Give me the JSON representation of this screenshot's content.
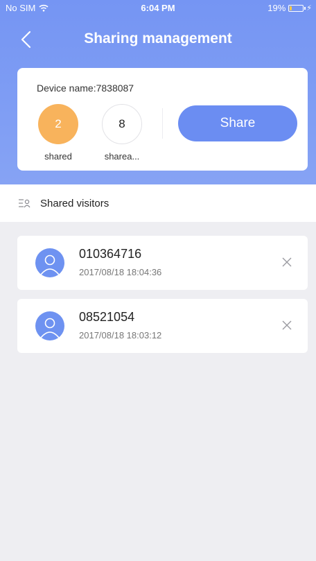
{
  "status_bar": {
    "carrier": "No SIM",
    "time": "6:04 PM",
    "battery": "19%",
    "battery_level": 0.19,
    "icons": [
      "wifi-icon",
      "battery-icon",
      "charging-icon"
    ]
  },
  "header": {
    "title": "Sharing management",
    "back_icon": "chevron-left-icon"
  },
  "device_card": {
    "device_name": "Device name:7838087",
    "shared_count": "2",
    "shared_label": "shared",
    "shareable_count": "8",
    "shareable_label": "sharea...",
    "share_button": "Share"
  },
  "visitors_section": {
    "title": "Shared visitors",
    "icon": "visitors-list-icon"
  },
  "visitors": [
    {
      "id": "010364716",
      "time": "2017/08/18 18:04:36"
    },
    {
      "id": "08521054",
      "time": "2017/08/18 18:03:12"
    }
  ],
  "colors": {
    "header_gradient_top": "#7595f3",
    "header_gradient_bottom": "#86a3f4",
    "accent": "#6b8df2",
    "shared_badge": "#f8b35c",
    "avatar": "#6e92f1",
    "background": "#eeeef2"
  }
}
